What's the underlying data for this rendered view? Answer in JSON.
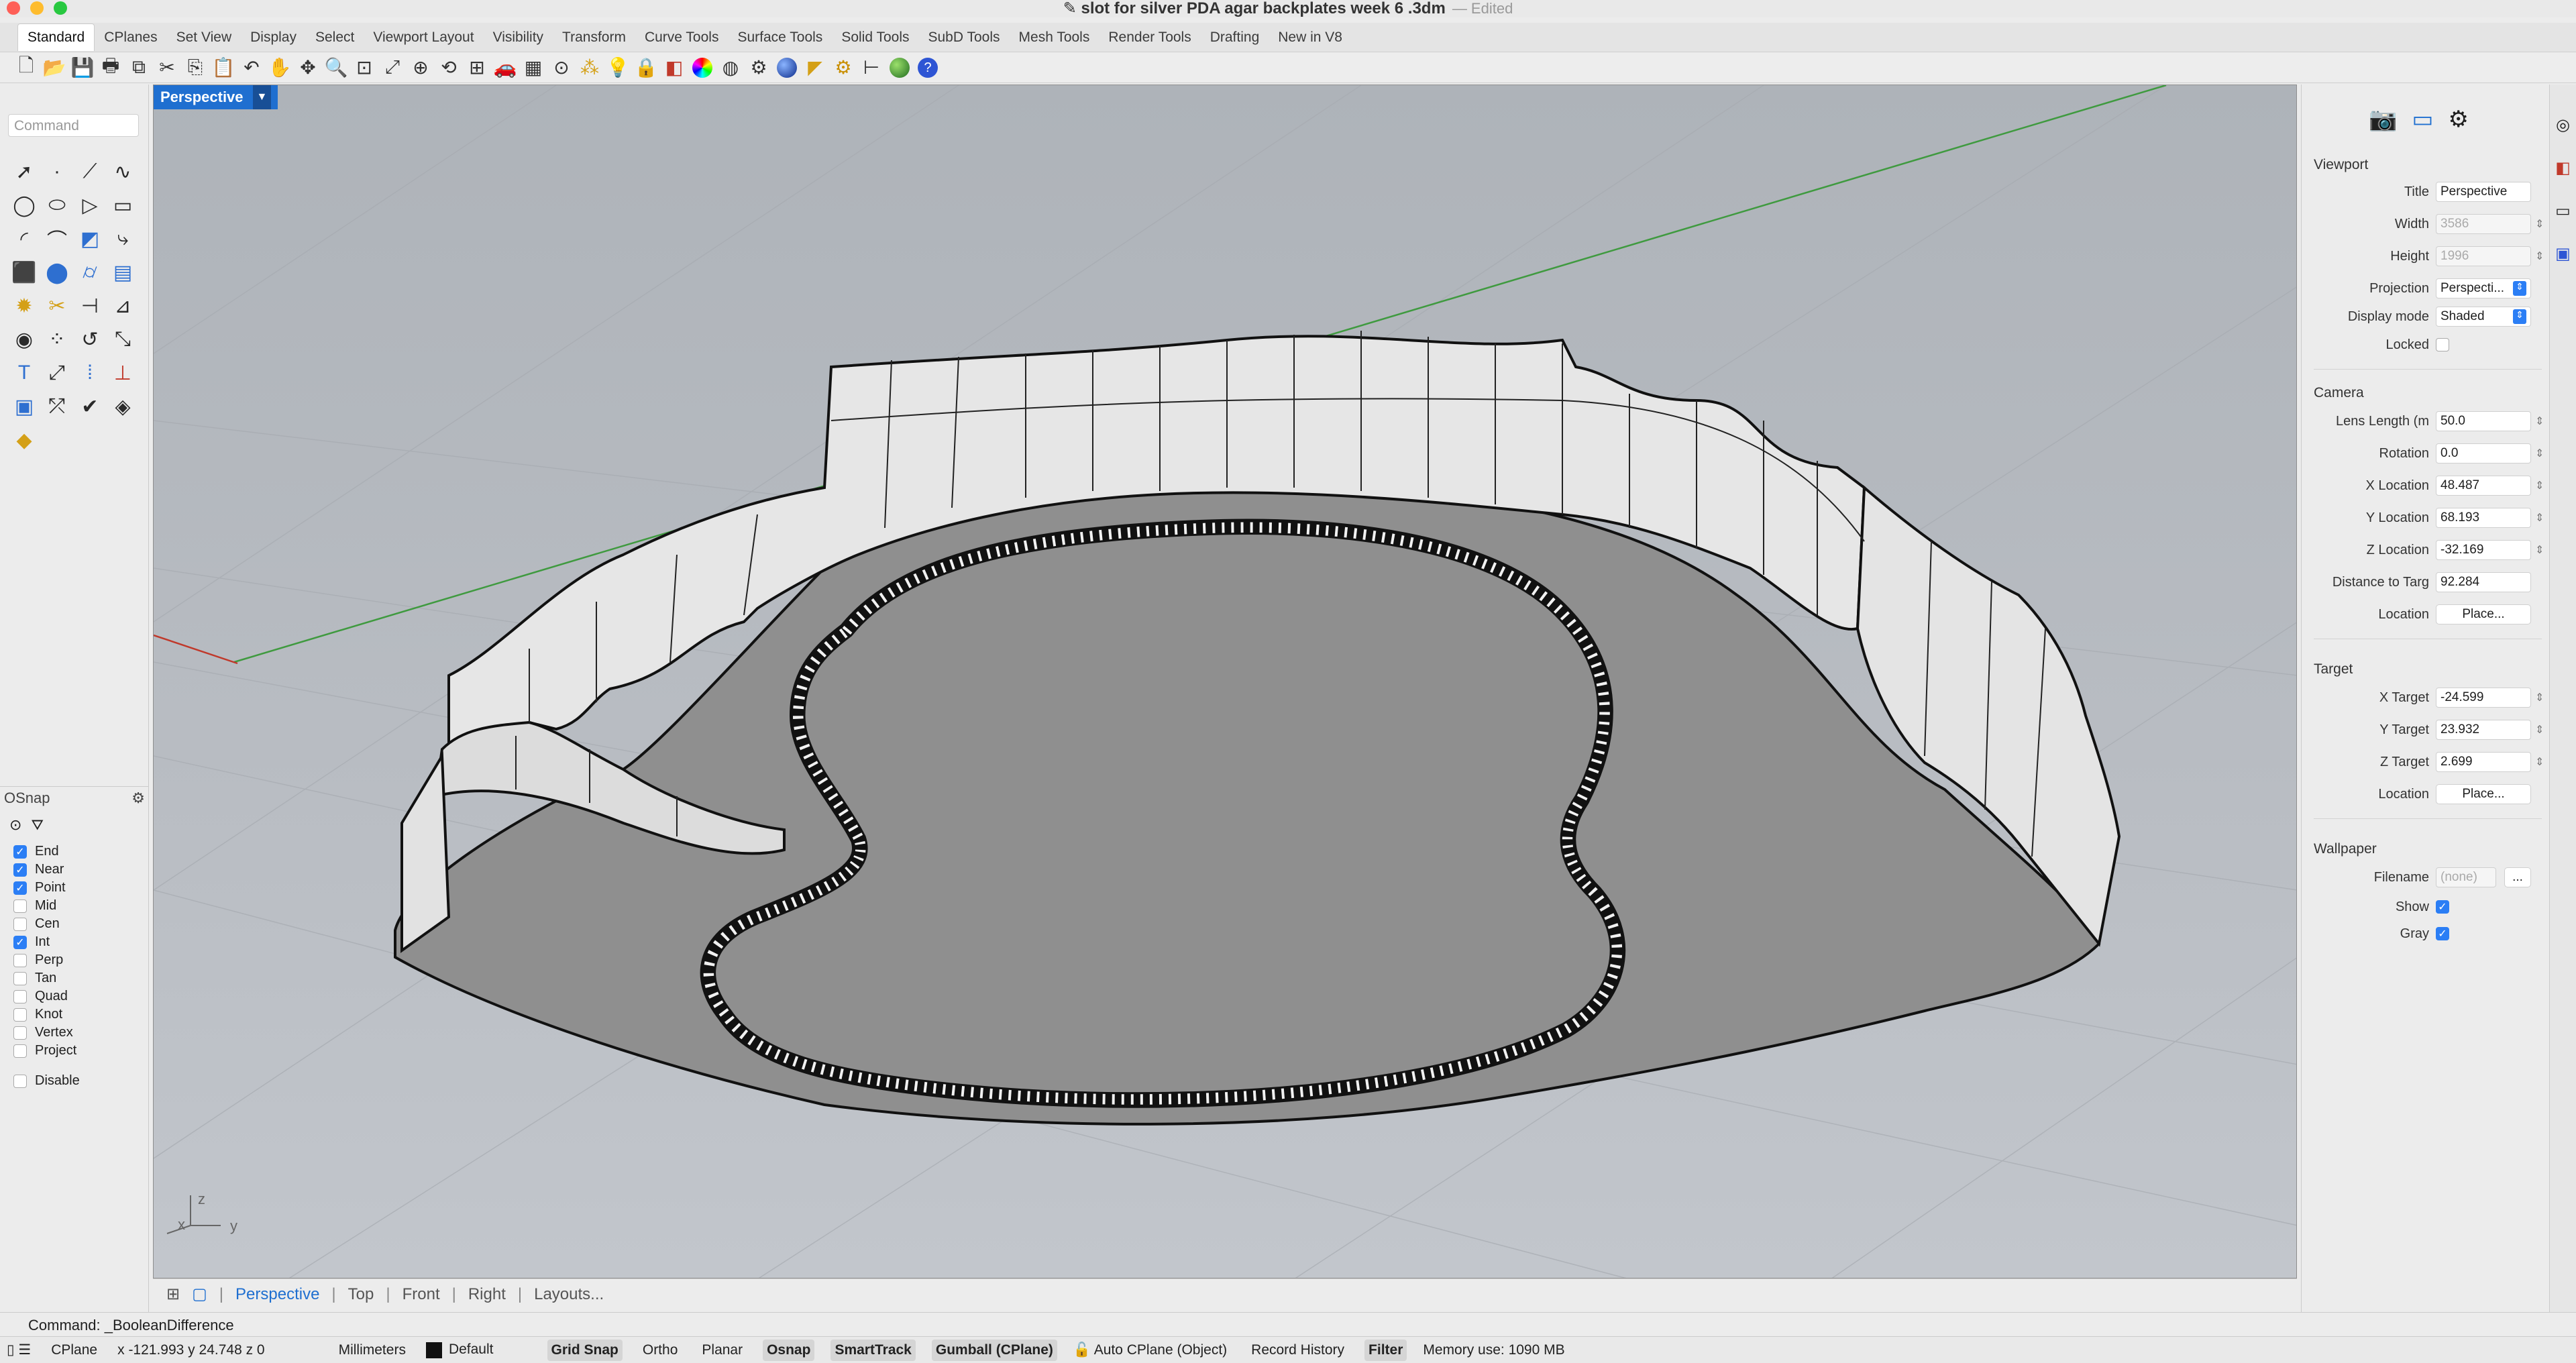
{
  "window": {
    "title": "slot for silver PDA agar backplates week 6 .3dm",
    "edited": "— Edited"
  },
  "tabs": [
    "Standard",
    "CPlanes",
    "Set View",
    "Display",
    "Select",
    "Viewport Layout",
    "Visibility",
    "Transform",
    "Curve Tools",
    "Surface Tools",
    "Solid Tools",
    "SubD Tools",
    "Mesh Tools",
    "Render Tools",
    "Drafting",
    "New in V8"
  ],
  "active_tab": "Standard",
  "command": {
    "placeholder": "Command",
    "last": "Command: _BooleanDifference"
  },
  "viewport": {
    "label": "Perspective",
    "axis_x": "x",
    "axis_y": "y",
    "axis_z": "z"
  },
  "viewport_tabs": [
    "Perspective",
    "Top",
    "Front",
    "Right",
    "Layouts..."
  ],
  "osnap": {
    "title": "OSnap",
    "items": [
      {
        "label": "End",
        "checked": true
      },
      {
        "label": "Near",
        "checked": true
      },
      {
        "label": "Point",
        "checked": true
      },
      {
        "label": "Mid",
        "checked": false
      },
      {
        "label": "Cen",
        "checked": false
      },
      {
        "label": "Int",
        "checked": true
      },
      {
        "label": "Perp",
        "checked": false
      },
      {
        "label": "Tan",
        "checked": false
      },
      {
        "label": "Quad",
        "checked": false
      },
      {
        "label": "Knot",
        "checked": false
      },
      {
        "label": "Vertex",
        "checked": false
      },
      {
        "label": "Project",
        "checked": false
      }
    ],
    "disable": "Disable"
  },
  "properties": {
    "viewport_section": "Viewport",
    "title_label": "Title",
    "title_value": "Perspective",
    "width_label": "Width",
    "width_value": "3586",
    "height_label": "Height",
    "height_value": "1996",
    "projection_label": "Projection",
    "projection_value": "Perspecti...",
    "display_label": "Display mode",
    "display_value": "Shaded",
    "locked_label": "Locked",
    "camera_section": "Camera",
    "lens_label": "Lens Length (m",
    "lens_value": "50.0",
    "rotation_label": "Rotation",
    "rotation_value": "0.0",
    "xloc_label": "X Location",
    "xloc_value": "48.487",
    "yloc_label": "Y Location",
    "yloc_value": "68.193",
    "zloc_label": "Z Location",
    "zloc_value": "-32.169",
    "dist_label": "Distance to Targ",
    "dist_value": "92.284",
    "loc_label": "Location",
    "place_label": "Place...",
    "target_section": "Target",
    "xtar_label": "X Target",
    "xtar_value": "-24.599",
    "ytar_label": "Y Target",
    "ytar_value": "23.932",
    "ztar_label": "Z Target",
    "ztar_value": "2.699",
    "tloc_label": "Location",
    "tplace_label": "Place...",
    "wallpaper_section": "Wallpaper",
    "filename_label": "Filename",
    "filename_value": "(none)",
    "browse_label": "...",
    "show_label": "Show",
    "gray_label": "Gray"
  },
  "status": {
    "cplane": "CPlane",
    "coords": "x -121.993  y 24.748  z 0",
    "units": "Millimeters",
    "layer": "Default",
    "grid_snap": "Grid Snap",
    "ortho": "Ortho",
    "planar": "Planar",
    "osnap": "Osnap",
    "smarttrack": "SmartTrack",
    "gumball": "Gumball (CPlane)",
    "auto_cplane": "Auto CPlane (Object)",
    "record_history": "Record History",
    "filter": "Filter",
    "memory": "Memory use: 1090 MB"
  }
}
